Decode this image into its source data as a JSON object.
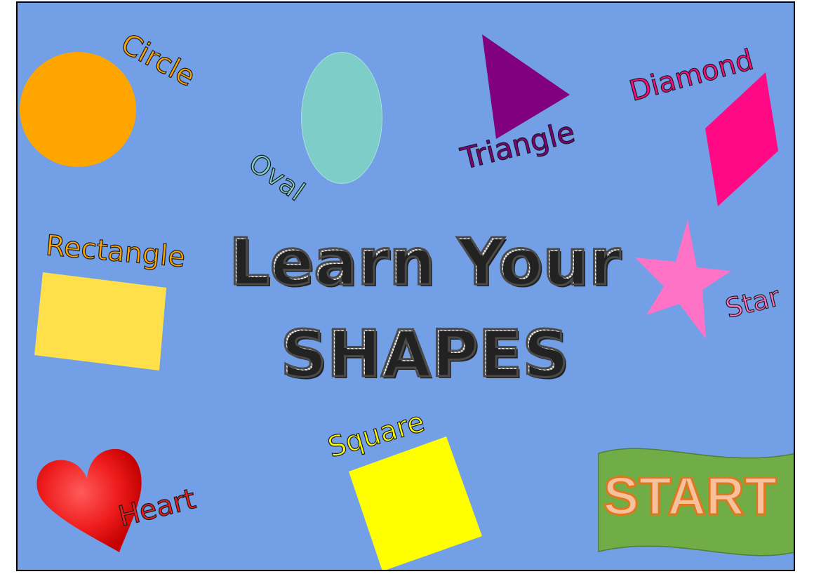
{
  "title": {
    "line1": "Learn Your",
    "line2": "SHAPES"
  },
  "labels": {
    "circle": "Circle",
    "oval": "Oval",
    "triangle": "Triangle",
    "diamond": "Diamond",
    "rectangle": "Rectangle",
    "star": "Star",
    "square": "Square",
    "heart": "Heart"
  },
  "start_button": {
    "label": "START"
  },
  "colors": {
    "background": "#729fe6",
    "circle": "#ffa500",
    "oval": "#7ecdc8",
    "triangle": "#800080",
    "diamond": "#ff0a84",
    "rectangle": "#ffe04a",
    "star": "#ff73c6",
    "square": "#ffff00",
    "heart": "#ee1c1c",
    "start_button": "#70ad47",
    "start_text": "#f6c19c"
  }
}
